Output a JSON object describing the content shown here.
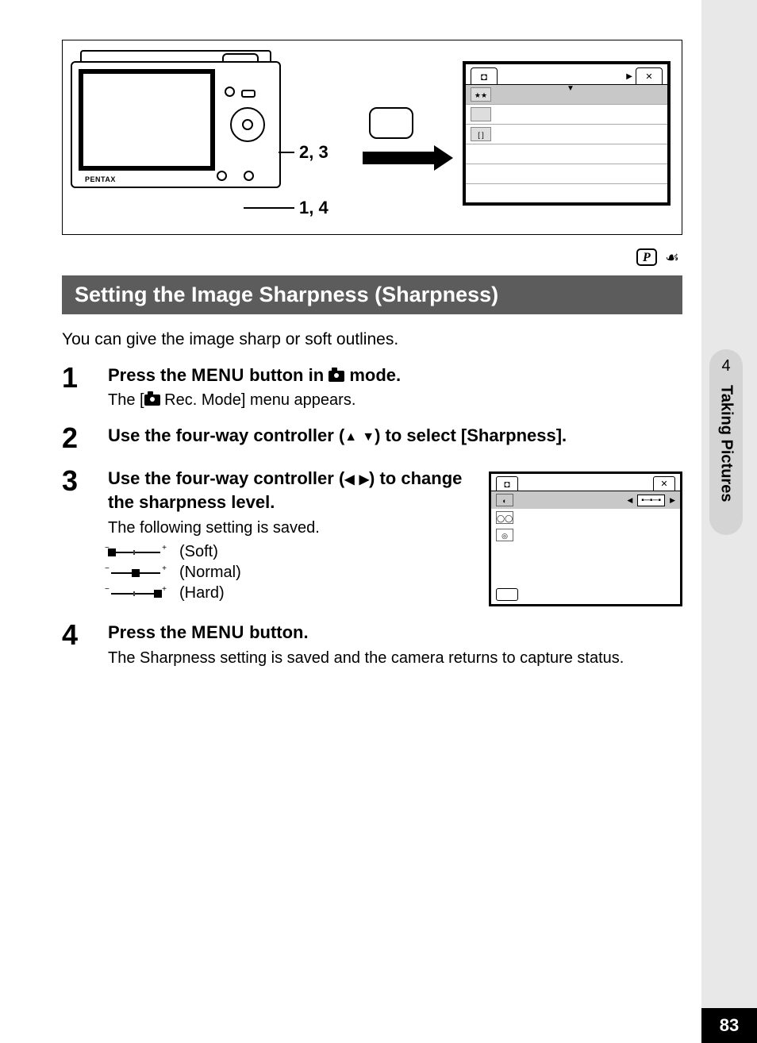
{
  "camera_brand": "PENTAX",
  "diagram_callout_1": "2, 3",
  "diagram_callout_2": "1, 4",
  "mode_badge_p": "P",
  "heading": "Setting the Image Sharpness (Sharpness)",
  "intro": "You can give the image sharp or soft outlines.",
  "steps": {
    "s1_num": "1",
    "s1_title_a": "Press the ",
    "s1_title_menu": "MENU",
    "s1_title_b": " button in ",
    "s1_title_c": " mode.",
    "s1_sup_a": "The [",
    "s1_sup_b": " Rec. Mode] menu appears.",
    "s2_num": "2",
    "s2_title_a": "Use the four-way controller (",
    "s2_title_b": ") to select [Sharpness].",
    "s3_num": "3",
    "s3_title_a": "Use the four-way controller (",
    "s3_title_b": ") to change the sharpness level.",
    "s3_sup": "The following setting is saved.",
    "s3_soft": "(Soft)",
    "s3_normal": "(Normal)",
    "s3_hard": "(Hard)",
    "s4_num": "4",
    "s4_title_a": "Press the ",
    "s4_title_menu": "MENU",
    "s4_title_b": " button.",
    "s4_sup": "The Sharpness setting is saved and the camera returns to capture status."
  },
  "side_tab_num": "4",
  "side_tab_label": "Taking Pictures",
  "page_number": "83"
}
